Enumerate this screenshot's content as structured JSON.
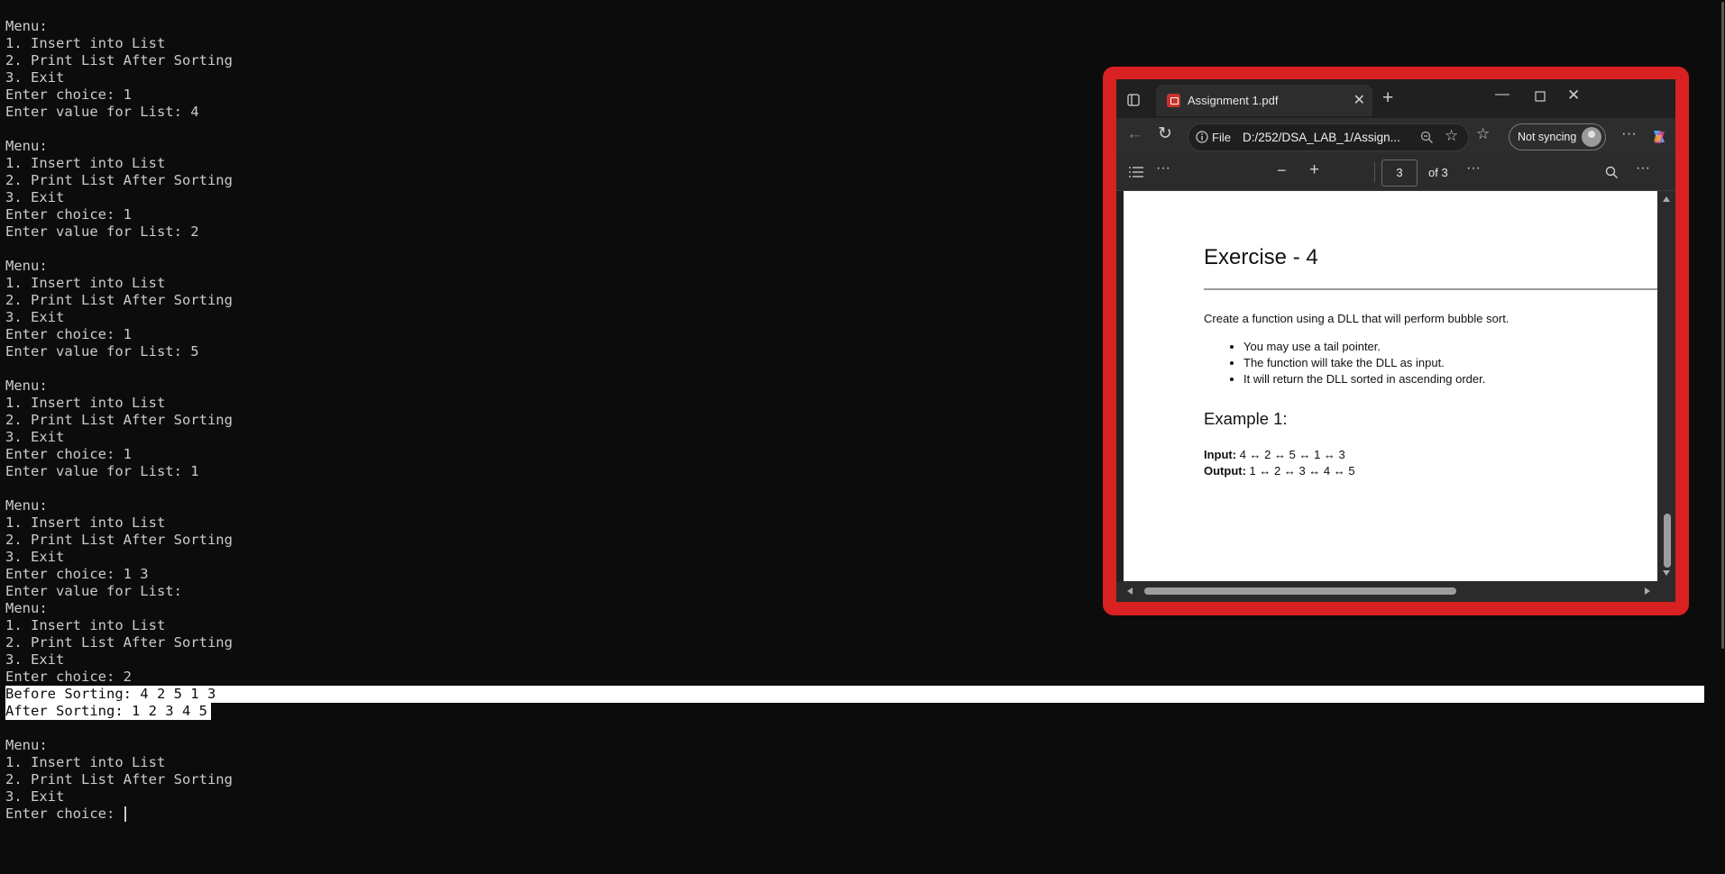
{
  "terminal": {
    "lines": [
      "Menu:",
      "1. Insert into List",
      "2. Print List After Sorting",
      "3. Exit",
      "Enter choice: 1",
      "Enter value for List: 4",
      "",
      "Menu:",
      "1. Insert into List",
      "2. Print List After Sorting",
      "3. Exit",
      "Enter choice: 1",
      "Enter value for List: 2",
      "",
      "Menu:",
      "1. Insert into List",
      "2. Print List After Sorting",
      "3. Exit",
      "Enter choice: 1",
      "Enter value for List: 5",
      "",
      "Menu:",
      "1. Insert into List",
      "2. Print List After Sorting",
      "3. Exit",
      "Enter choice: 1",
      "Enter value for List: 1",
      "",
      "Menu:",
      "1. Insert into List",
      "2. Print List After Sorting",
      "3. Exit",
      "Enter choice: 1 3",
      "Enter value for List:",
      "Menu:",
      "1. Insert into List",
      "2. Print List After Sorting",
      "3. Exit",
      "Enter choice: 2",
      "Before Sorting: 4 2 5 1 3",
      "After Sorting: 1 2 3 4 5",
      "",
      "Menu:",
      "1. Insert into List",
      "2. Print List After Sorting",
      "3. Exit",
      "Enter choice: "
    ],
    "highlighted_lines": [
      39,
      40
    ]
  },
  "browser": {
    "tab_title": "Assignment 1.pdf",
    "tab_icon": "pdf-file-icon",
    "address": {
      "scheme_label": "File",
      "url": "D:/252/DSA_LAB_1/Assign..."
    },
    "profile_button": "Not syncing",
    "pdf_toolbar": {
      "current_page": "3",
      "page_total": "of 3"
    }
  },
  "pdf_page": {
    "title": "Exercise - 4",
    "intro": "Create a function using a DLL that will perform bubble sort.",
    "bullets": [
      "You may use a tail pointer.",
      "The function will take the DLL as input.",
      "It will return the DLL sorted in ascending order."
    ],
    "example_heading": "Example 1:",
    "input_label": "Input:",
    "input_value": " 4 ↔ 2 ↔ 5 ↔ 1 ↔ 3",
    "output_label": "Output:",
    "output_value": " 1 ↔ 2 ↔ 3 ↔ 4 ↔ 5"
  }
}
